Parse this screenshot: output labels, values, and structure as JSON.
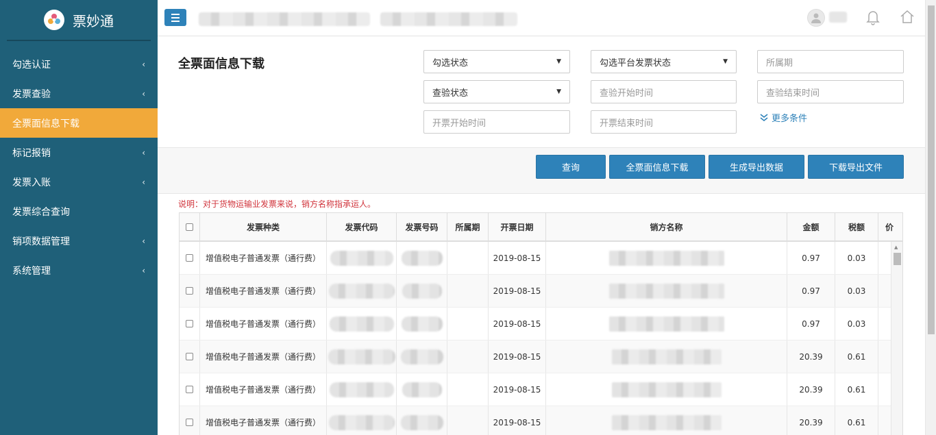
{
  "brand": {
    "name": "票妙通"
  },
  "sidebar": {
    "items": [
      {
        "label": "勾选认证",
        "has_children": true,
        "active": false
      },
      {
        "label": "发票查验",
        "has_children": true,
        "active": false
      },
      {
        "label": "全票面信息下载",
        "has_children": false,
        "active": true
      },
      {
        "label": "标记报销",
        "has_children": true,
        "active": false
      },
      {
        "label": "发票入账",
        "has_children": true,
        "active": false
      },
      {
        "label": "发票综合查询",
        "has_children": false,
        "active": false
      },
      {
        "label": "销项数据管理",
        "has_children": true,
        "active": false
      },
      {
        "label": "系统管理",
        "has_children": true,
        "active": false
      }
    ]
  },
  "colors": {
    "sidebar": "#1f6079",
    "active": "#f1a93a",
    "primary": "#2e82b9",
    "note": "#d0333b"
  },
  "page": {
    "title": "全票面信息下载"
  },
  "filters": {
    "check_status": "勾选状态",
    "platform_status": "勾选平台发票状态",
    "period_placeholder": "所属期",
    "verify_status": "查验状态",
    "verify_start_placeholder": "查验开始时间",
    "verify_end_placeholder": "查验结束时间",
    "issue_start_placeholder": "开票开始时间",
    "issue_end_placeholder": "开票结束时间",
    "more_label": "更多条件"
  },
  "actions": {
    "query": "查询",
    "download_all": "全票面信息下载",
    "generate_export": "生成导出数据",
    "download_export": "下载导出文件"
  },
  "note": "说明：对于货物运输业发票来说，销方名称指承运人。",
  "table": {
    "headers": [
      "发票种类",
      "发票代码",
      "发票号码",
      "所属期",
      "开票日期",
      "销方名称",
      "金额",
      "税额",
      "价"
    ],
    "rows": [
      {
        "type": "增值税电子普通发票（通行费）",
        "date": "2019-08-15",
        "amount": "0.97",
        "tax": "0.03"
      },
      {
        "type": "增值税电子普通发票（通行费）",
        "date": "2019-08-15",
        "amount": "0.97",
        "tax": "0.03"
      },
      {
        "type": "增值税电子普通发票（通行费）",
        "date": "2019-08-15",
        "amount": "0.97",
        "tax": "0.03"
      },
      {
        "type": "增值税电子普通发票（通行费）",
        "date": "2019-08-15",
        "amount": "20.39",
        "tax": "0.61"
      },
      {
        "type": "增值税电子普通发票（通行费）",
        "date": "2019-08-15",
        "amount": "20.39",
        "tax": "0.61"
      },
      {
        "type": "增值税电子普通发票（通行费）",
        "date": "2019-08-15",
        "amount": "20.39",
        "tax": "0.61"
      }
    ]
  }
}
